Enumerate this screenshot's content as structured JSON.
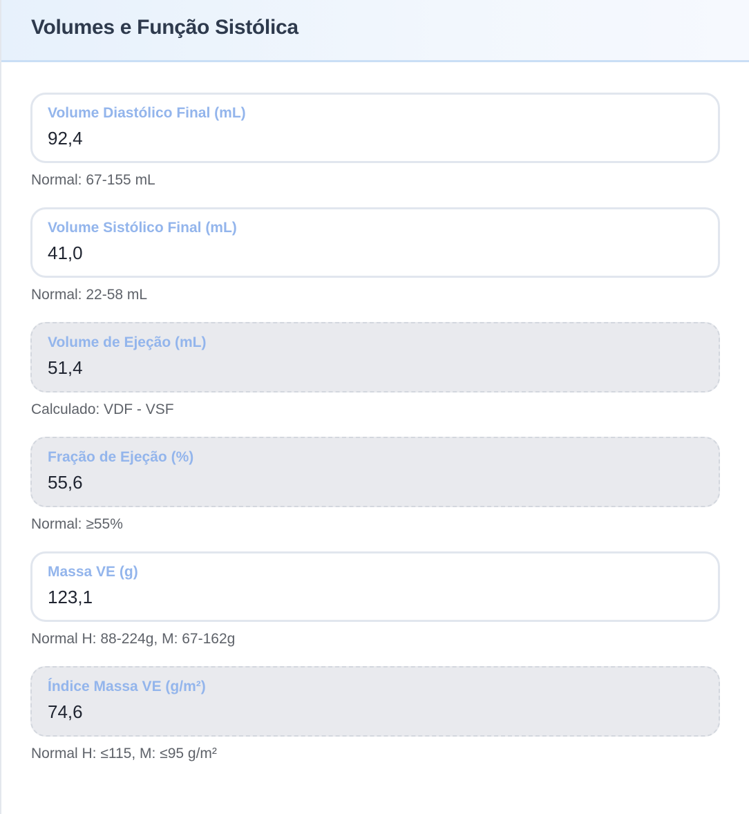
{
  "header": {
    "title": "Volumes e Função Sistólica"
  },
  "fields": [
    {
      "label": "Volume Diastólico Final (mL)",
      "value": "92,4",
      "hint": "Normal: 67-155 mL",
      "computed": false
    },
    {
      "label": "Volume Sistólico Final (mL)",
      "value": "41,0",
      "hint": "Normal: 22-58 mL",
      "computed": false
    },
    {
      "label": "Volume de Ejeção (mL)",
      "value": "51,4",
      "hint": "Calculado: VDF - VSF",
      "computed": true
    },
    {
      "label": "Fração de Ejeção (%)",
      "value": "55,6",
      "hint": "Normal: ≥55%",
      "computed": true
    },
    {
      "label": "Massa VE (g)",
      "value": "123,1",
      "hint": "Normal H: 88-224g, M: 67-162g",
      "computed": false
    },
    {
      "label": "Índice Massa VE (g/m²)",
      "value": "74,6",
      "hint": "Normal H: ≤115, M: ≤95 g/m²",
      "computed": true
    }
  ],
  "colors": {
    "label": "#93b5ec",
    "header_bg": "#e7f1fc",
    "computed_bg": "#e9eaee"
  }
}
